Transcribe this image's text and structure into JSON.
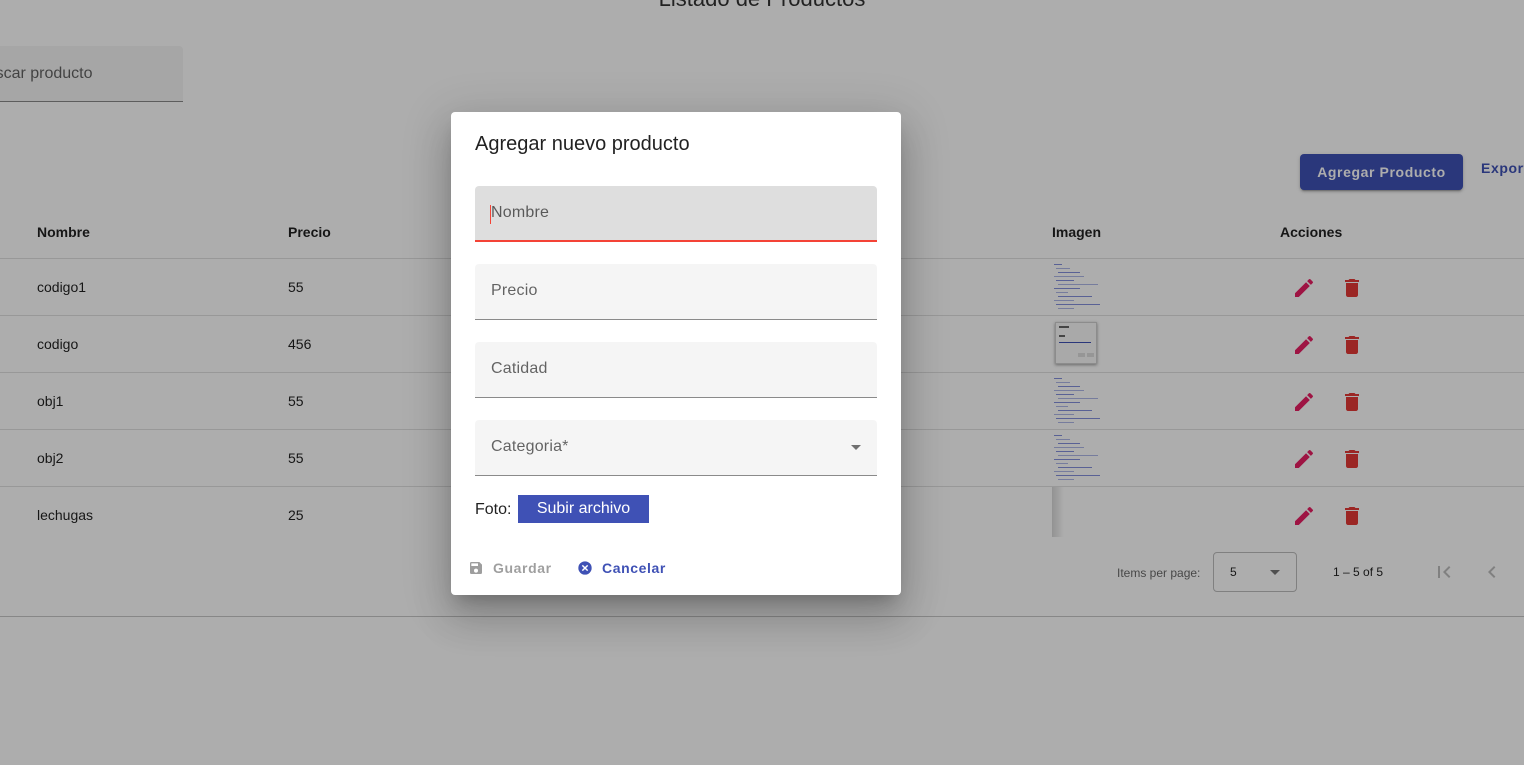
{
  "page": {
    "title": "Listado de Productos",
    "search_placeholder": "Buscar producto",
    "add_button": "Agregar Producto",
    "export_button": "Exportar"
  },
  "table": {
    "headers": {
      "nombre": "Nombre",
      "precio": "Precio",
      "imagen": "Imagen",
      "acciones": "Acciones"
    },
    "rows": [
      {
        "nombre": "codigo1",
        "precio": "55",
        "image": "code-screenshot"
      },
      {
        "nombre": "codigo",
        "precio": "456",
        "image": "dialog-screenshot"
      },
      {
        "nombre": "obj1",
        "precio": "55",
        "image": "code-screenshot"
      },
      {
        "nombre": "obj2",
        "precio": "55",
        "image": "code-screenshot"
      },
      {
        "nombre": "lechugas",
        "precio": "25",
        "image": "blank"
      }
    ],
    "action_icons": [
      "edit-icon",
      "delete-icon"
    ]
  },
  "paginator": {
    "items_per_page_label": "Items per page:",
    "page_size": "5",
    "range_label": "1 – 5 of 5"
  },
  "dialog": {
    "title": "Agregar nuevo producto",
    "fields": {
      "nombre": "Nombre",
      "precio": "Precio",
      "cantidad": "Catidad",
      "categoria": "Categoria*"
    },
    "foto_label": "Foto:",
    "upload_button": "Subir archivo",
    "save_button": "Guardar",
    "cancel_button": "Cancelar"
  },
  "colors": {
    "primary": "#3f51b5",
    "accent": "#e91e63",
    "warn": "#e53935",
    "focus_error": "#f44336"
  }
}
